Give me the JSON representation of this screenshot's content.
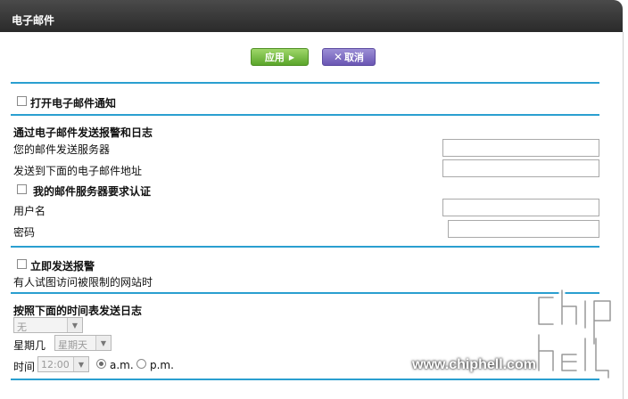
{
  "header": {
    "title": "电子邮件"
  },
  "toolbar": {
    "apply_label": "应用",
    "cancel_label": "取消"
  },
  "sections": {
    "email_notify": {
      "label": "打开电子邮件通知",
      "checked": false
    },
    "send_logs": {
      "heading": "通过电子邮件发送报警和日志",
      "smtp_label": "您的邮件发送服务器",
      "smtp_value": "",
      "to_label": "发送到下面的电子邮件地址",
      "to_value": "",
      "auth_label": "我的邮件服务器要求认证",
      "auth_checked": false,
      "username_label": "用户名",
      "username_value": "",
      "password_label": "密码",
      "password_value": ""
    },
    "alert": {
      "label": "立即发送报警",
      "checked": false,
      "desc": "有人试图访问被限制的网站时"
    },
    "schedule": {
      "heading": "按照下面的时间表发送日志",
      "frequency_value": "无",
      "weekday_label": "星期几",
      "weekday_value": "星期天",
      "time_label": "时间",
      "time_value": "12:00",
      "am_label": "a.m.",
      "pm_label": "p.m.",
      "am_selected": true
    }
  },
  "watermark": {
    "url": "www.chiphell.com"
  },
  "icons": {
    "apply": "play-triangle-icon",
    "cancel": "close-icon"
  },
  "colors": {
    "header": "#333333",
    "rule": "#2a9fd0",
    "apply": "#6bbf3a",
    "cancel": "#7a67c2"
  }
}
